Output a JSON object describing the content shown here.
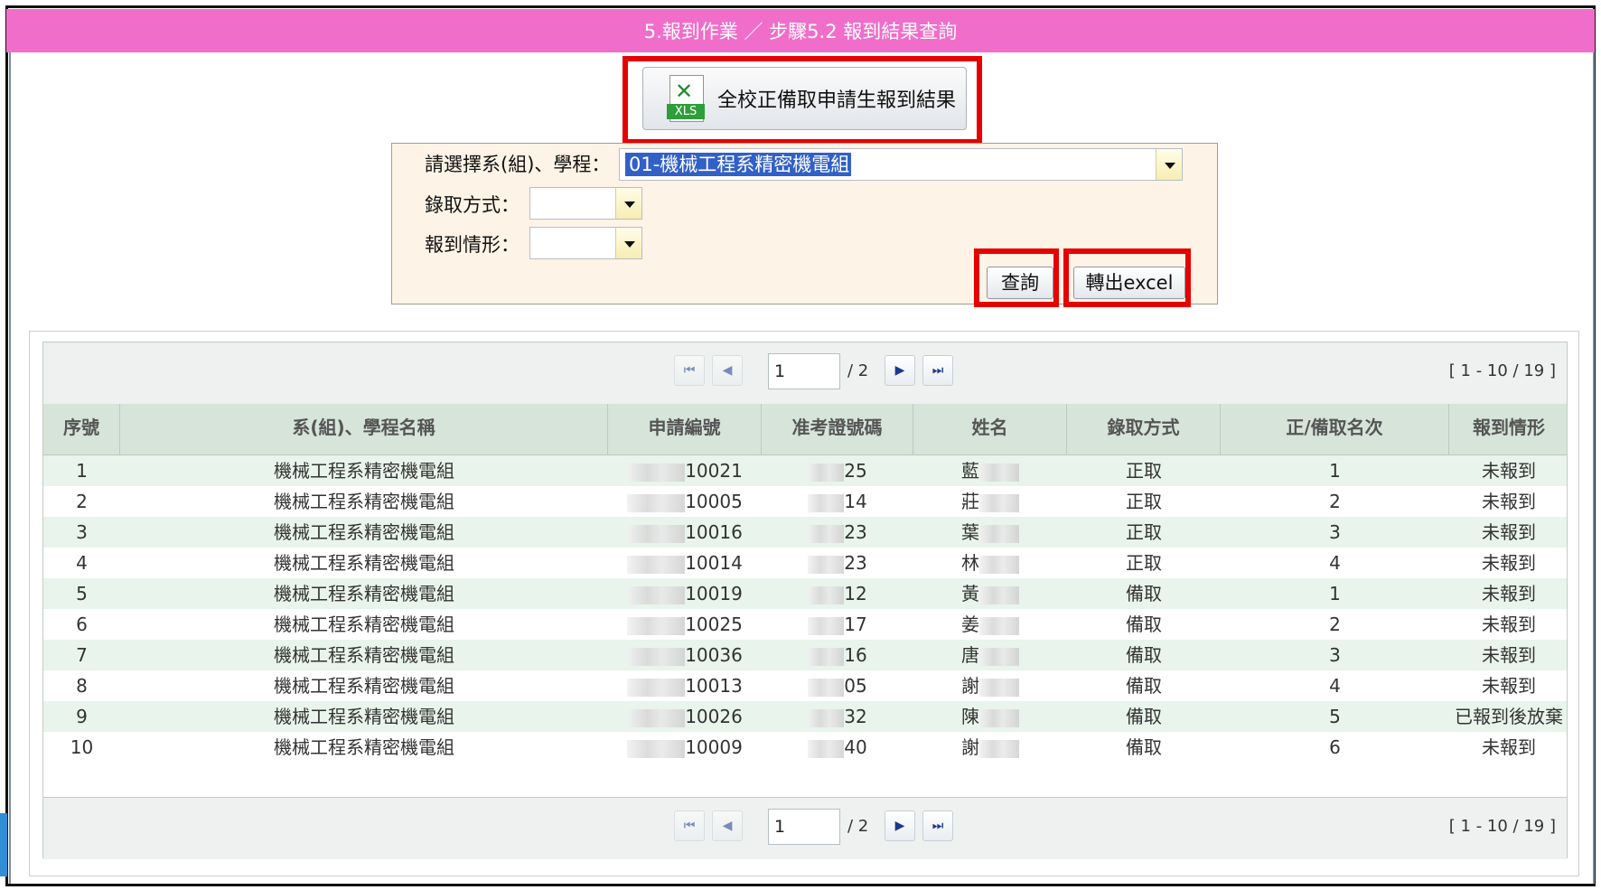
{
  "header": {
    "title": "5.報到作業 ／ 步驟5.2 報到結果查詢"
  },
  "export_all": {
    "label": "全校正備取申請生報到結果",
    "icon_text": "XLS"
  },
  "filter": {
    "dept_label": "請選擇系(組)、學程：",
    "dept_value": "01-機械工程系精密機電組",
    "admit_label": "錄取方式：",
    "admit_value": "",
    "status_label": "報到情形：",
    "status_value": "",
    "query_label": "查詢",
    "export_label": "轉出excel"
  },
  "pager": {
    "page": "1",
    "total": "/ 2",
    "info": "[ 1 - 10 / 19 ]"
  },
  "table": {
    "headers": [
      "序號",
      "系(組)、學程名稱",
      "申請編號",
      "准考證號碼",
      "姓名",
      "錄取方式",
      "正/備取名次",
      "報到情形"
    ],
    "rows": [
      {
        "no": "1",
        "dept": "機械工程系精密機電組",
        "app": "10021",
        "exam": "25",
        "name": "藍",
        "admit": "正取",
        "rank": "1",
        "status": "未報到"
      },
      {
        "no": "2",
        "dept": "機械工程系精密機電組",
        "app": "10005",
        "exam": "14",
        "name": "莊",
        "admit": "正取",
        "rank": "2",
        "status": "未報到"
      },
      {
        "no": "3",
        "dept": "機械工程系精密機電組",
        "app": "10016",
        "exam": "23",
        "name": "葉",
        "admit": "正取",
        "rank": "3",
        "status": "未報到"
      },
      {
        "no": "4",
        "dept": "機械工程系精密機電組",
        "app": "10014",
        "exam": "23",
        "name": "林",
        "admit": "正取",
        "rank": "4",
        "status": "未報到"
      },
      {
        "no": "5",
        "dept": "機械工程系精密機電組",
        "app": "10019",
        "exam": "12",
        "name": "黃",
        "admit": "備取",
        "rank": "1",
        "status": "未報到"
      },
      {
        "no": "6",
        "dept": "機械工程系精密機電組",
        "app": "10025",
        "exam": "17",
        "name": "姜",
        "admit": "備取",
        "rank": "2",
        "status": "未報到"
      },
      {
        "no": "7",
        "dept": "機械工程系精密機電組",
        "app": "10036",
        "exam": "16",
        "name": "唐",
        "admit": "備取",
        "rank": "3",
        "status": "未報到"
      },
      {
        "no": "8",
        "dept": "機械工程系精密機電組",
        "app": "10013",
        "exam": "05",
        "name": "謝",
        "admit": "備取",
        "rank": "4",
        "status": "未報到"
      },
      {
        "no": "9",
        "dept": "機械工程系精密機電組",
        "app": "10026",
        "exam": "32",
        "name": "陳",
        "admit": "備取",
        "rank": "5",
        "status": "已報到後放棄"
      },
      {
        "no": "10",
        "dept": "機械工程系精密機電組",
        "app": "10009",
        "exam": "40",
        "name": "謝",
        "admit": "備取",
        "rank": "6",
        "status": "未報到"
      }
    ]
  },
  "colors": {
    "header_bg": "#f06ec9",
    "highlight_red": "#e60000",
    "row_alt": "#e9f4ec",
    "table_head": "#d6e4da"
  }
}
